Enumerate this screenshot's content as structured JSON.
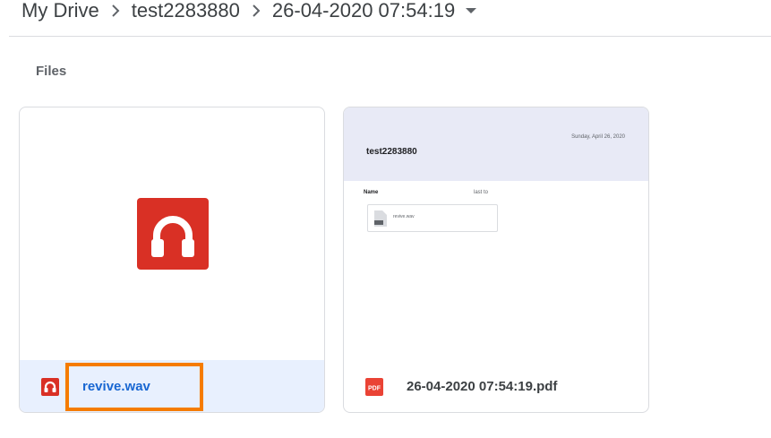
{
  "breadcrumb": {
    "items": [
      "My Drive",
      "test2283880",
      "26-04-2020 07:54:19"
    ]
  },
  "section": {
    "title": "Files"
  },
  "files": [
    {
      "name": "revive.wav",
      "type": "audio",
      "icon": "headphones-icon",
      "selected": true
    },
    {
      "name": "26-04-2020 07:54:19.pdf",
      "type": "pdf",
      "icon": "pdf-icon",
      "selected": false,
      "preview": {
        "date": "Sunday, April 26, 2020",
        "title": "test2283880",
        "column_name": "Name",
        "column_last": "last to",
        "file_label": "revive.wav"
      }
    }
  ],
  "colors": {
    "selected_bg": "#e8f0fe",
    "selected_text": "#1967d2",
    "audio_red": "#d93025",
    "highlight": "#f57c00"
  }
}
